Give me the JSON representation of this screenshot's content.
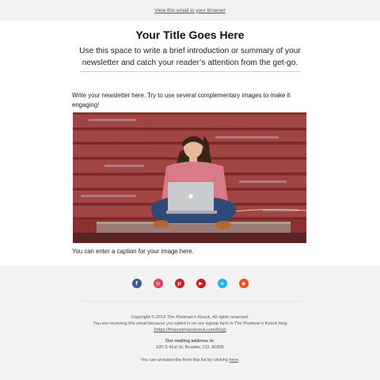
{
  "header": {
    "view_in_browser": "View this email in your browser"
  },
  "main": {
    "title": "Your Title Goes Here",
    "intro": "Use this space to write a brief introduction or summary of your newsletter and catch your reader’s attention from the get-go.",
    "body": "Write your newsletter here. Try to use several complementary images to make it engaging!",
    "caption": "You can enter a caption for your image here."
  },
  "social": [
    {
      "name": "facebook-icon",
      "glyph": "f",
      "color": "#3b5998"
    },
    {
      "name": "instagram-icon",
      "glyph": "◎",
      "color": "#e4405f"
    },
    {
      "name": "pinterest-icon",
      "glyph": "p",
      "color": "#cb2027"
    },
    {
      "name": "youtube-icon",
      "glyph": "▶",
      "color": "#cc181e"
    },
    {
      "name": "vimeo-icon",
      "glyph": "v",
      "color": "#1ab7ea"
    },
    {
      "name": "reddit-icon",
      "glyph": "◉",
      "color": "#ff4500"
    }
  ],
  "footer": {
    "copyright": "Copyright © 2019 The Postman’s Knock, All rights reserved.",
    "reason": "You are receiving this email because you opted in on our signup form in The Postman’s Knock blog",
    "blog_link": "(https://thepostmansknock.com/blog)",
    "mailing_heading": "Our mailing address is:",
    "address": "520 S 41st St, Boulder, CO, 80305",
    "unsubscribe_prefix": "You can unsubscribe from this list by clicking ",
    "unsubscribe_link": "here",
    "unsubscribe_suffix": "."
  }
}
